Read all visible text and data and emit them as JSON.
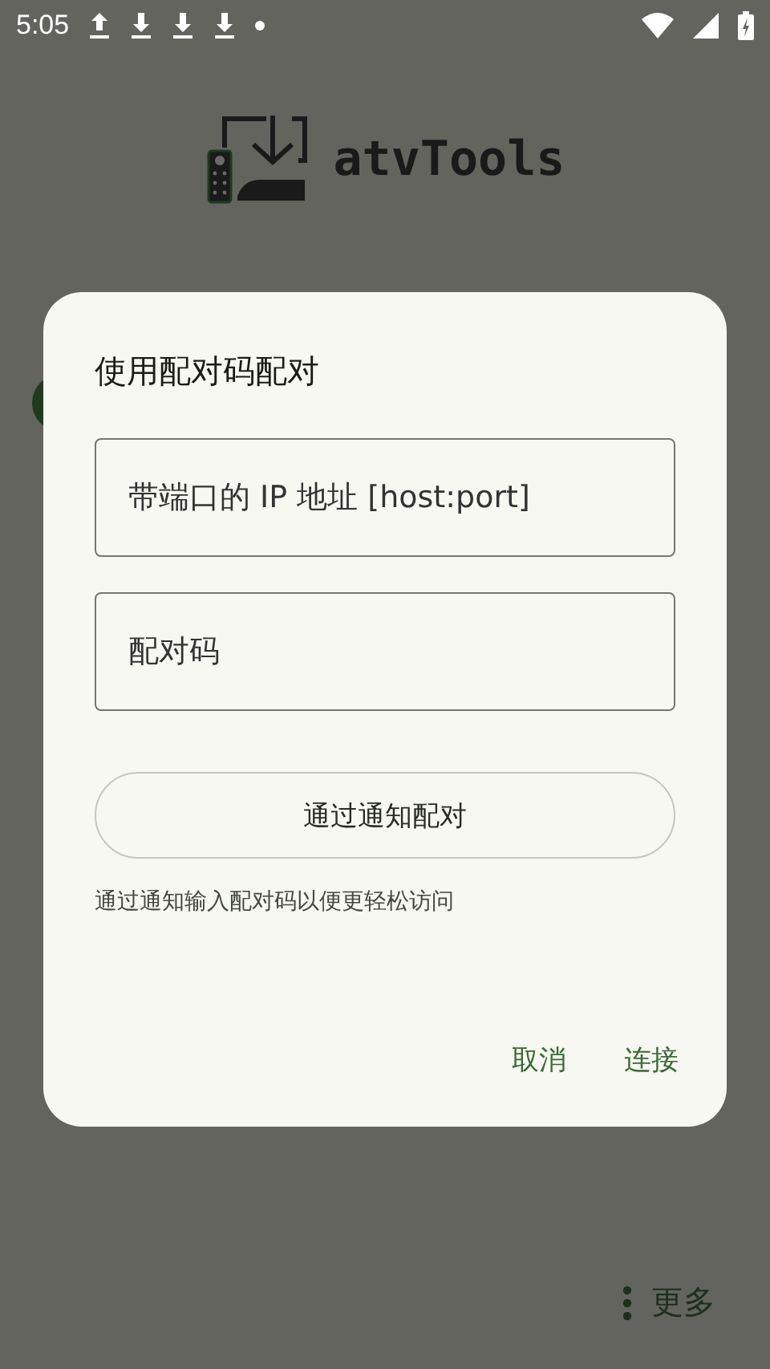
{
  "status_bar": {
    "time": "5:05"
  },
  "app": {
    "title": "atvTools"
  },
  "dialog": {
    "title": "使用配对码配对",
    "fields": [
      {
        "placeholder": "带端口的 IP 地址 [host:port]"
      },
      {
        "placeholder": "配对码"
      }
    ],
    "notify_button": "通过通知配对",
    "hint": "通过通知输入配对码以便更轻松访问",
    "buttons": [
      "取消",
      "连接"
    ]
  },
  "more_button": "更多"
}
